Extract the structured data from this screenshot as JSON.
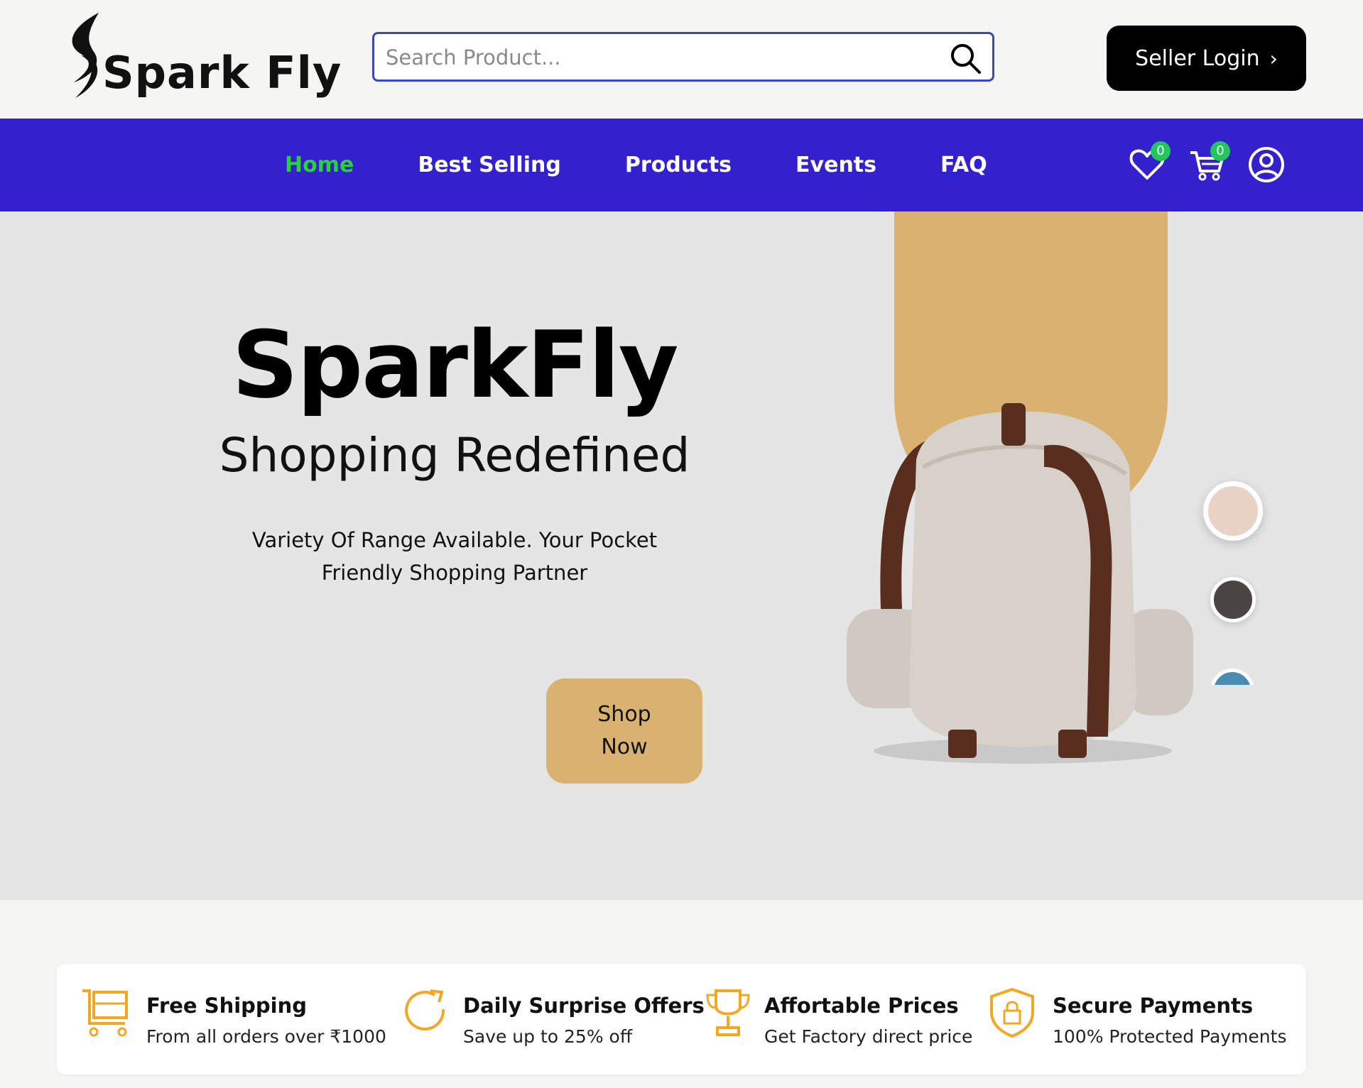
{
  "header": {
    "logo_text": "Spark Fly",
    "search_placeholder": "Search Product...",
    "seller_button": "Seller Login",
    "seller_chevron": "›"
  },
  "nav": {
    "links": [
      "Home",
      "Best Selling",
      "Products",
      "Events",
      "FAQ"
    ],
    "active": "Home",
    "wishlist_count": "0",
    "cart_count": "0",
    "icons": [
      "heart-icon",
      "cart-icon",
      "user-icon"
    ]
  },
  "hero": {
    "title": "SparkFly",
    "subtitle": "Shopping Redefined",
    "description": "Variety Of Range Available. Your Pocket Friendly Shopping Partner",
    "cta": "Shop\nNow",
    "swatches": [
      "#e8d2c4",
      "#4a4442",
      "#4a8bb0"
    ]
  },
  "features": [
    {
      "title": "Free Shipping",
      "subtitle": "From all orders over ₹1000",
      "icon": "cart-icon"
    },
    {
      "title": "Daily Surprise Offers",
      "subtitle": "Save up to 25% off",
      "icon": "refresh-icon"
    },
    {
      "title": "Affortable Prices",
      "subtitle": "Get Factory direct price",
      "icon": "trophy-icon"
    },
    {
      "title": "Secure Payments",
      "subtitle": "100% Protected Payments",
      "icon": "shield-lock-icon"
    }
  ],
  "colors": {
    "nav_bg": "#3221cc",
    "active_link": "#2ecc40",
    "accent": "#d9b271",
    "badge": "#22c55e",
    "feature_icon": "#f5a623"
  }
}
